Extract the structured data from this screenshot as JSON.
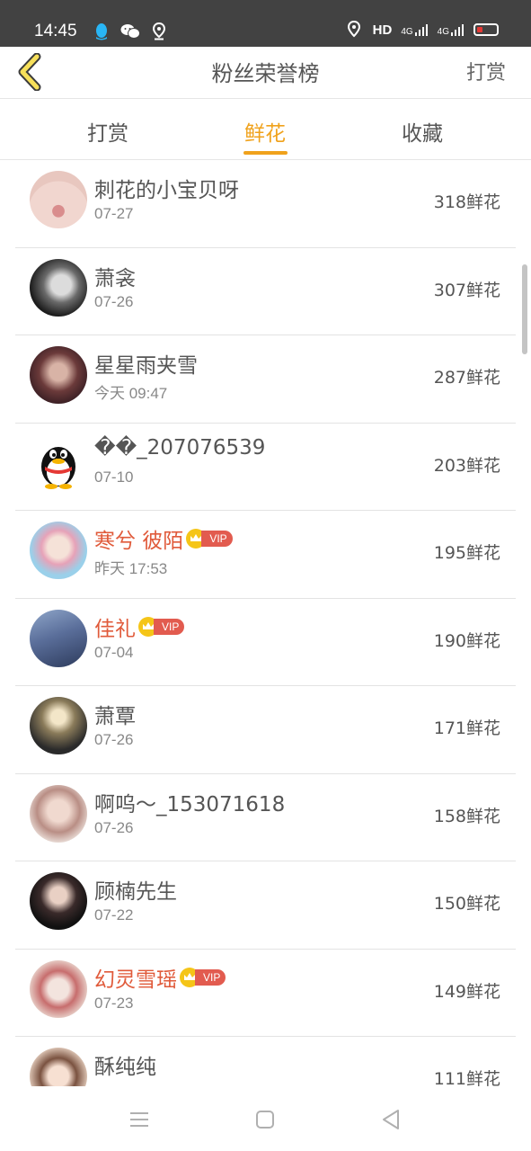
{
  "status_bar": {
    "time": "14:45",
    "hd_label": "HD",
    "net1": "4G",
    "net2": "4G",
    "left_icons": [
      "qq-icon",
      "wechat-icon",
      "location-pin-icon"
    ],
    "right_icons": [
      "location-icon",
      "signal-icon",
      "battery-icon"
    ]
  },
  "header": {
    "title": "粉丝荣誉榜",
    "right_action": "打赏",
    "accent_color": "#f0a21c"
  },
  "tabs": [
    {
      "label": "打赏",
      "active": false
    },
    {
      "label": "鲜花",
      "active": true
    },
    {
      "label": "收藏",
      "active": false
    }
  ],
  "vip_label": "VIP",
  "rows": [
    {
      "name": "刺花的小宝贝呀",
      "date": "07-27",
      "count": "318鲜花",
      "vip": false
    },
    {
      "name": "萧衾",
      "date": "07-26",
      "count": "307鲜花",
      "vip": false
    },
    {
      "name": "星星雨夹雪",
      "date": "今天 09:47",
      "count": "287鲜花",
      "vip": false
    },
    {
      "name": "��_207076539",
      "date": "07-10",
      "count": "203鲜花",
      "vip": false
    },
    {
      "name": "寒兮 彼陌",
      "date": "昨天 17:53",
      "count": "195鲜花",
      "vip": true
    },
    {
      "name": "佳礼",
      "date": "07-04",
      "count": "190鲜花",
      "vip": true
    },
    {
      "name": "萧覃",
      "date": "07-26",
      "count": "171鲜花",
      "vip": false
    },
    {
      "name": "啊呜～_153071618",
      "date": "07-26",
      "count": "158鲜花",
      "vip": false
    },
    {
      "name": "顾楠先生",
      "date": "07-22",
      "count": "150鲜花",
      "vip": false
    },
    {
      "name": "幻灵雪瑶",
      "date": "07-23",
      "count": "149鲜花",
      "vip": true
    },
    {
      "name": "酥纯纯",
      "date": "",
      "count": "111鲜花",
      "vip": false
    }
  ],
  "nav_icons": [
    "menu-icon",
    "home-square-icon",
    "back-triangle-icon"
  ]
}
